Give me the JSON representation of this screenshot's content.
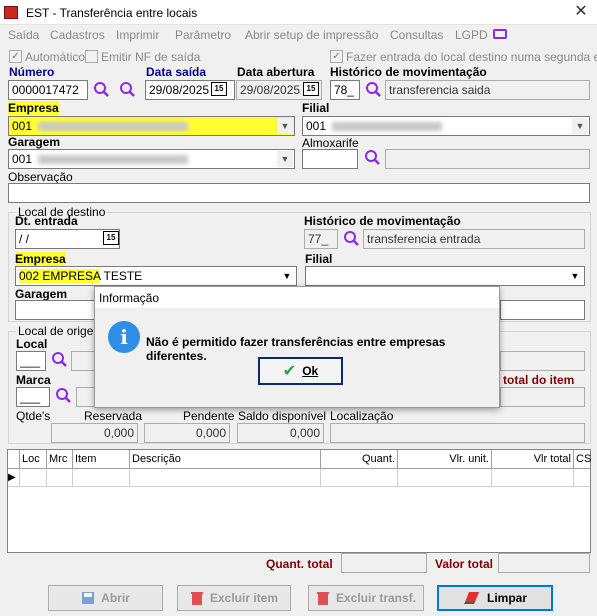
{
  "window": {
    "title": "EST - Transferência entre locais"
  },
  "menu": [
    "Saída",
    "Cadastros",
    "Imprimir",
    "Parâmetro",
    "Abrir setup de impressão",
    "Consultas",
    "LGPD"
  ],
  "options": {
    "automatico": "Automático",
    "emitir_nf": "Emitir NF de saída",
    "fazer_entrada": "Fazer entrada do local destino numa segunda etapa"
  },
  "header": {
    "numero_label": "Número",
    "numero_value": "0000017472",
    "data_saida_label": "Data saída",
    "data_saida_value": "29/08/2025",
    "data_abertura_label": "Data abertura",
    "data_abertura_value": "29/08/2025",
    "historico_label": "Histórico de movimentação",
    "historico_code": "78_",
    "historico_desc": "transferencia saida",
    "calendar_icon_text": "15"
  },
  "origem": {
    "empresa_label": "Empresa",
    "empresa_value": "001",
    "filial_label": "Filial",
    "filial_value": "001",
    "garagem_label": "Garagem",
    "garagem_value": "001",
    "almoxarife_label": "Almoxarife",
    "observacao_label": "Observação"
  },
  "destino": {
    "group_title": "Local de destino",
    "dt_entrada_label": "Dt. entrada",
    "dt_entrada_value": " /  /",
    "historico_label": "Histórico de movimentação",
    "historico_code": "77_",
    "historico_desc": "transferencia entrada",
    "empresa_label": "Empresa",
    "empresa_value_code": "002 EMPRESA",
    "empresa_value_rest": " TESTE",
    "filial_label": "Filial",
    "garagem_label": "Garagem"
  },
  "local_origem": {
    "group_title": "Local de origem",
    "local_label": "Local",
    "local_value": "___",
    "marca_label": "Marca",
    "marca_value": "___",
    "total_item_label": "total do item",
    "qtdes_label": "Qtde's",
    "reservada_label": "Reservada",
    "reservada_value": "0,000",
    "pendente_label": "Pendente",
    "pendente_value": "0,000",
    "saldo_label": "Saldo disponível",
    "saldo_value": "0,000",
    "localizacao_label": "Localização"
  },
  "grid": {
    "columns": [
      "Loc",
      "Mrc",
      "Item",
      "Descrição",
      "Quant.",
      "Vlr. unit.",
      "Vlr total",
      "CS"
    ],
    "row_indicator": "▶"
  },
  "totals": {
    "quant_total_label": "Quant. total",
    "valor_total_label": "Valor total"
  },
  "buttons": {
    "abrir": "Abrir",
    "excluir_item": "Excluir item",
    "excluir_transf": "Excluir transf.",
    "limpar": "Limpar"
  },
  "dialog": {
    "title": "Informação",
    "message": "Não é permitido fazer transferências entre empresas diferentes.",
    "ok_label": "Ok",
    "info_glyph": "i"
  },
  "colors": {
    "label_blue": "#00008b",
    "highlight_yellow": "#ffff33",
    "label_maroon": "#800000",
    "info_blue": "#2f8ee6",
    "lgpd_purple": "#8a2be2"
  }
}
